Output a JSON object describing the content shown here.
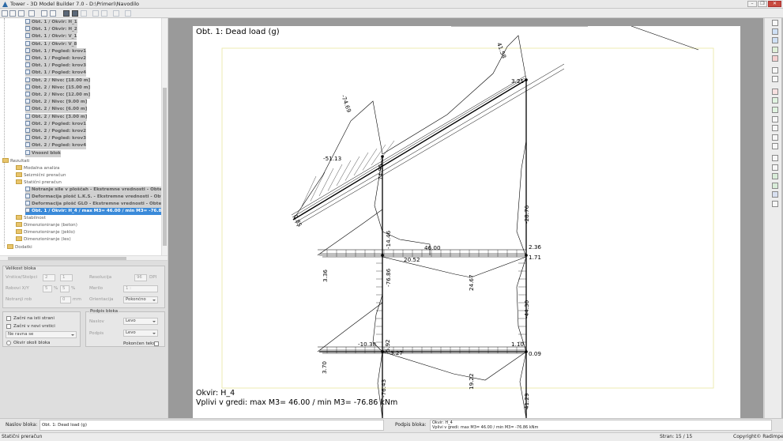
{
  "window": {
    "title": "Tower - 3D Model Builder 7.0 - D:\\Primeri\\Navodilo",
    "min": "–",
    "max": "❐",
    "close": "✕"
  },
  "tree": {
    "items": [
      {
        "l": "Obt. 1 / Okvir: H_1",
        "b": 1
      },
      {
        "l": "Obt. 1 / Okvir: H_2",
        "b": 1
      },
      {
        "l": "Obt. 1 / Okvir: V_1",
        "b": 1
      },
      {
        "l": "Obt. 1 / Okvir: V_8",
        "b": 1
      },
      {
        "l": "Obt. 1 / Pogled: krov1",
        "b": 1
      },
      {
        "l": "Obt. 1 / Pogled: krov2",
        "b": 1
      },
      {
        "l": "Obt. 1 / Pogled: krov3",
        "b": 1
      },
      {
        "l": "Obt. 1 / Pogled: krov4",
        "b": 1
      },
      {
        "l": "Obt. 2 / Nivo: [18.00 m]",
        "b": 1
      },
      {
        "l": "Obt. 2 / Nivo: [15.00 m]",
        "b": 1
      },
      {
        "l": "Obt. 2 / Nivo: [12.00 m]",
        "b": 1
      },
      {
        "l": "Obt. 2 / Nivo: [9.00 m]",
        "b": 1
      },
      {
        "l": "Obt. 2 / Nivo: [6.00 m]",
        "b": 1
      },
      {
        "l": "Obt. 2 / Nivo: [3.00 m]",
        "b": 1
      },
      {
        "l": "Obt. 2 / Pogled: krov1",
        "b": 1
      },
      {
        "l": "Obt. 2 / Pogled: krov2",
        "b": 1
      },
      {
        "l": "Obt. 2 / Pogled: krov3",
        "b": 1
      },
      {
        "l": "Obt. 2 / Pogled: krov4",
        "b": 1
      },
      {
        "l": "Vnosni blok",
        "b": 1
      },
      {
        "l": "Rezultati",
        "b": 0
      },
      {
        "l": "Modalna analiza",
        "b": 0
      },
      {
        "l": "Seizmični preračun",
        "b": 0
      },
      {
        "l": "Statični preračun",
        "b": 0
      },
      {
        "l": "Notranje sile v ploščah - Ekstremne vrednosti - Obtežba",
        "b": 1
      },
      {
        "l": "Deformacija plošč L.K.S. - Ekstremne vrednosti - Obtežba",
        "b": 1
      },
      {
        "l": "Deformacija plošč GLO - Ekstremne vrednosti - Obtežba",
        "b": 1
      },
      {
        "l": "Obt. 1 / Okvir: H_4 / max M3= 46.00 / min M3= -76.86 kNm",
        "b": 1
      },
      {
        "l": "Stabilnost",
        "b": 0
      },
      {
        "l": "Dimenzioniranje (beton)",
        "b": 0
      },
      {
        "l": "Dimenzioniranje (jeklo)",
        "b": 0
      },
      {
        "l": "Dimenzioniranje (les)",
        "b": 0
      },
      {
        "l": "Dodatki",
        "b": 0
      }
    ]
  },
  "props": {
    "size_group": "Velikost bloka",
    "w_label": "Vrstice/Stolpci",
    "w1": "2",
    "w2": "1",
    "margin_label": "Robovi X/Y",
    "m1": "5",
    "m_pct": "%",
    "m2": "5",
    "m_pct2": "%",
    "inner_label": "Notranji rob",
    "inner_val": "0",
    "inner_unit": "mm",
    "res_label": "Resolucija",
    "res_val": "96",
    "res_unit": "DPI",
    "scale_label": "Merilo",
    "scale_val": "1 :",
    "orient_label": "Orientacija",
    "orient_val": "Pokončno",
    "cb1": "Začni na isti strani",
    "cb2": "Začni v novi vrstici",
    "align_val": "Ne ravna se",
    "frame_label": "Okvir okoli bloka",
    "sig_group": "Podpis bloka",
    "naslov_label": "Naslov",
    "naslov_val": "Levo",
    "podpis_label": "Podpis",
    "podpis_val": "Levo",
    "vert_label": "Pokončen tekst"
  },
  "paper": {
    "title": "Obt. 1: Dead load (g)",
    "foot1": "Okvir: H_4",
    "foot2": "Vplivi v gredi: max M3= 46.00 / min M3= -76.86 kNm"
  },
  "diagram_labels": [
    "41.58",
    "3.21",
    "-51.13",
    "-74.69",
    "0.85",
    "74.95",
    "-28.76",
    "-14.46",
    "46.00",
    "20.52",
    "2.36",
    "1.71",
    "3.36",
    "-76.86",
    "24.67",
    "-44.30",
    "-5.92",
    "-10.38",
    "1.10",
    "3.27",
    "0.09",
    "3.70",
    "-76.43",
    "19.22",
    "41.29"
  ],
  "bottom": {
    "naslov_label": "Naslov bloka:",
    "naslov_val": "Obt. 1: Dead load (g)",
    "podpis_label": "Podpis bloka:",
    "podpis_l1": "Okvir: H_4",
    "podpis_l2": "Vplivi v gredi: max M3= 46.00 / min M3= -76.86 kNm"
  },
  "status": {
    "left": "Statični preračun",
    "page": "Stran: 15 / 15",
    "copyright": "Copyright© Radimpex"
  }
}
